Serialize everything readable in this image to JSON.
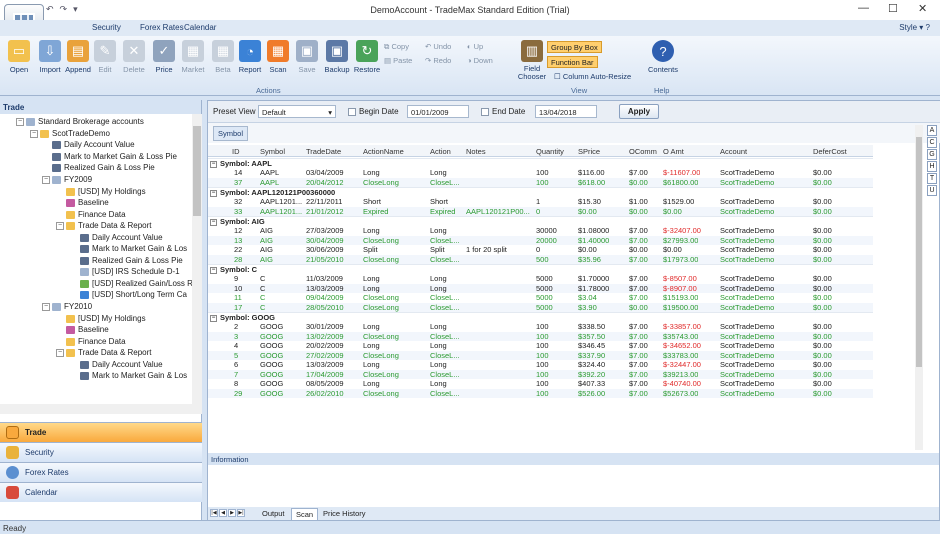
{
  "window": {
    "title": "DemoAccount - TradeMax Standard Edition (Trial)",
    "minimize": "—",
    "maximize": "☐",
    "close": "✕"
  },
  "qat": {
    "undo": "↶",
    "redo": "↷",
    "more": "▾"
  },
  "menu": {
    "tabs": [
      "Security",
      "Forex Rates",
      "Calendar"
    ],
    "style": "Style",
    "help": "?"
  },
  "ribbon": {
    "actions": [
      "Open",
      "Import",
      "Append",
      "Edit",
      "Delete",
      "Price",
      "Market",
      "Beta",
      "Report",
      "Scan",
      "Save",
      "Backup",
      "Restore"
    ],
    "small": [
      "Copy",
      "Paste",
      "Undo",
      "Redo",
      "Up",
      "Down"
    ],
    "view": {
      "field_chooser": "Field Chooser",
      "group_by_box": "Group By Box",
      "function_bar": "Function Bar",
      "autoresize": "Column Auto-Resize"
    },
    "contents": "Contents",
    "groups": [
      "Actions",
      "View",
      "Help"
    ]
  },
  "left": {
    "header": "Trade",
    "tree": [
      "Standard Brokerage accounts",
      "ScotTradeDemo",
      "Daily Account Value",
      "Mark to Market Gain & Loss Pie",
      "Realized Gain & Loss Pie",
      "FY2009",
      "[USD] My Holdings",
      "Baseline",
      "Finance Data",
      "Trade Data & Report",
      "Daily Account Value",
      "Mark to Market Gain & Los",
      "Realized Gain & Loss Pie",
      "[USD] IRS Schedule D-1",
      "[USD] Realized Gain/Loss R",
      "[USD] Short/Long Term Ca",
      "FY2010",
      "[USD] My Holdings",
      "Baseline",
      "Finance Data",
      "Trade Data & Report",
      "Daily Account Value",
      "Mark to Market Gain & Los"
    ],
    "nav": [
      "Trade",
      "Security",
      "Forex Rates",
      "Calendar"
    ]
  },
  "toolbar": {
    "preset_label": "Preset View",
    "preset_value": "Default",
    "begin_label": "Begin Date",
    "begin_value": "01/01/2009",
    "end_label": "End Date",
    "end_value": "13/04/2018",
    "apply": "Apply"
  },
  "groupby": {
    "chip": "Symbol"
  },
  "grid": {
    "headers": [
      "ID",
      "Symbol",
      "TradeDate",
      "ActionName",
      "Action",
      "Notes",
      "Quantity",
      "SPrice",
      "OComm",
      "O Amt",
      "Account",
      "DeferCost"
    ],
    "groups": [
      {
        "label": "Symbol: AAPL",
        "rows": [
          [
            "14",
            "AAPL",
            "03/04/2009",
            "Long",
            "Long",
            "",
            "100",
            "$116.00",
            "$7.00",
            "$-11607.00",
            "ScotTradeDemo",
            "$0.00"
          ],
          [
            "37",
            "AAPL",
            "20/04/2012",
            "CloseLong",
            "CloseL...",
            "",
            "100",
            "$618.00",
            "$0.00",
            "$61800.00",
            "ScotTradeDemo",
            "$0.00"
          ]
        ]
      },
      {
        "label": "Symbol: AAPL120121P00360000",
        "rows": [
          [
            "32",
            "AAPL1201...",
            "22/11/2011",
            "Short",
            "Short",
            "",
            "1",
            "$15.30",
            "$1.00",
            "$1529.00",
            "ScotTradeDemo",
            "$0.00"
          ],
          [
            "33",
            "AAPL1201...",
            "21/01/2012",
            "Expired",
            "Expired",
            "AAPL120121P00...",
            "0",
            "$0.00",
            "$0.00",
            "$0.00",
            "ScotTradeDemo",
            "$0.00"
          ]
        ]
      },
      {
        "label": "Symbol: AIG",
        "rows": [
          [
            "12",
            "AIG",
            "27/03/2009",
            "Long",
            "Long",
            "",
            "30000",
            "$1.08000",
            "$7.00",
            "$-32407.00",
            "ScotTradeDemo",
            "$0.00"
          ],
          [
            "13",
            "AIG",
            "30/04/2009",
            "CloseLong",
            "CloseL...",
            "",
            "20000",
            "$1.40000",
            "$7.00",
            "$27993.00",
            "ScotTradeDemo",
            "$0.00"
          ],
          [
            "22",
            "AIG",
            "30/06/2009",
            "Split",
            "Split",
            "1 for 20 split",
            "0",
            "$0.00",
            "$0.00",
            "$0.00",
            "ScotTradeDemo",
            "$0.00"
          ],
          [
            "28",
            "AIG",
            "21/05/2010",
            "CloseLong",
            "CloseL...",
            "",
            "500",
            "$35.96",
            "$7.00",
            "$17973.00",
            "ScotTradeDemo",
            "$0.00"
          ]
        ]
      },
      {
        "label": "Symbol: C",
        "rows": [
          [
            "9",
            "C",
            "11/03/2009",
            "Long",
            "Long",
            "",
            "5000",
            "$1.70000",
            "$7.00",
            "$-8507.00",
            "ScotTradeDemo",
            "$0.00"
          ],
          [
            "10",
            "C",
            "13/03/2009",
            "Long",
            "Long",
            "",
            "5000",
            "$1.78000",
            "$7.00",
            "$-8907.00",
            "ScotTradeDemo",
            "$0.00"
          ],
          [
            "11",
            "C",
            "09/04/2009",
            "CloseLong",
            "CloseL...",
            "",
            "5000",
            "$3.04",
            "$7.00",
            "$15193.00",
            "ScotTradeDemo",
            "$0.00"
          ],
          [
            "17",
            "C",
            "28/05/2010",
            "CloseLong",
            "CloseL...",
            "",
            "5000",
            "$3.90",
            "$0.00",
            "$19500.00",
            "ScotTradeDemo",
            "$0.00"
          ]
        ]
      },
      {
        "label": "Symbol: GOOG",
        "rows": [
          [
            "2",
            "GOOG",
            "30/01/2009",
            "Long",
            "Long",
            "",
            "100",
            "$338.50",
            "$7.00",
            "$-33857.00",
            "ScotTradeDemo",
            "$0.00"
          ],
          [
            "3",
            "GOOG",
            "13/02/2009",
            "CloseLong",
            "CloseL...",
            "",
            "100",
            "$357.50",
            "$7.00",
            "$35743.00",
            "ScotTradeDemo",
            "$0.00"
          ],
          [
            "4",
            "GOOG",
            "20/02/2009",
            "Long",
            "Long",
            "",
            "100",
            "$346.45",
            "$7.00",
            "$-34652.00",
            "ScotTradeDemo",
            "$0.00"
          ],
          [
            "5",
            "GOOG",
            "27/02/2009",
            "CloseLong",
            "CloseL...",
            "",
            "100",
            "$337.90",
            "$7.00",
            "$33783.00",
            "ScotTradeDemo",
            "$0.00"
          ],
          [
            "6",
            "GOOG",
            "13/03/2009",
            "Long",
            "Long",
            "",
            "100",
            "$324.40",
            "$7.00",
            "$-32447.00",
            "ScotTradeDemo",
            "$0.00"
          ],
          [
            "7",
            "GOOG",
            "17/04/2009",
            "CloseLong",
            "CloseL...",
            "",
            "100",
            "$392.20",
            "$7.00",
            "$39213.00",
            "ScotTradeDemo",
            "$0.00"
          ],
          [
            "8",
            "GOOG",
            "08/05/2009",
            "Long",
            "Long",
            "",
            "100",
            "$407.33",
            "$7.00",
            "$-40740.00",
            "ScotTradeDemo",
            "$0.00"
          ],
          [
            "29",
            "GOOG",
            "26/02/2010",
            "CloseLong",
            "CloseL...",
            "",
            "100",
            "$526.00",
            "$7.00",
            "$52673.00",
            "ScotTradeDemo",
            "$0.00"
          ]
        ]
      }
    ]
  },
  "alpha": [
    "A",
    "C",
    "G",
    "H",
    "T",
    "U"
  ],
  "info": {
    "title": "Information"
  },
  "bottomtabs": [
    "Output",
    "Scan",
    "Price History"
  ],
  "status": "Ready"
}
